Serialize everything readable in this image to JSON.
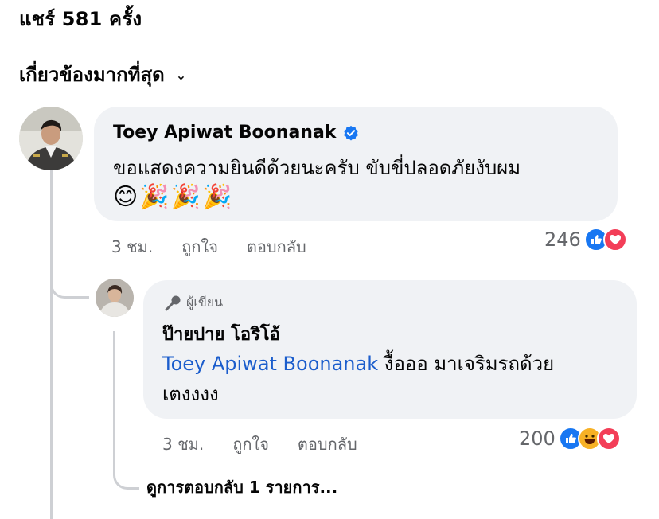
{
  "header": {
    "shares_label": "แชร์ 581 ครั้ง",
    "sort_label": "เกี่ยวข้องมากที่สุด"
  },
  "comment": {
    "author": "Toey Apiwat Boonanak",
    "verified": true,
    "text": "ขอแสดงความยินดีด้วยนะครับ ขับขี่ปลอดภัยงับผม",
    "emojis": [
      "😊",
      "🎉",
      "🎉",
      "🎉"
    ],
    "time": "3 ชม.",
    "like_label": "ถูกใจ",
    "reply_label": "ตอบกลับ",
    "reaction_count": "246",
    "reactions": [
      "like-icon",
      "love-icon"
    ]
  },
  "reply": {
    "badge_label": "ผู้เขียน",
    "author": "ป๊ายปาย โอริโอ้",
    "mention": "Toey Apiwat Boonanak",
    "text_after_mention": " งื้อออ มาเจริมรถด้วย",
    "text_line2": "เตงงงง",
    "time": "3 ชม.",
    "like_label": "ถูกใจ",
    "reply_label": "ตอบกลับ",
    "reaction_count": "200",
    "reactions": [
      "like-icon",
      "haha-icon",
      "love-icon"
    ]
  },
  "view_more_label": "ดูการตอบกลับ 1 รายการ...",
  "colors": {
    "bubble": "#f0f2f5",
    "meta_text": "#65676b",
    "mention": "#1b5dcc",
    "like": "#1877f2",
    "love": "#f33e58",
    "haha": "#f7b125"
  }
}
